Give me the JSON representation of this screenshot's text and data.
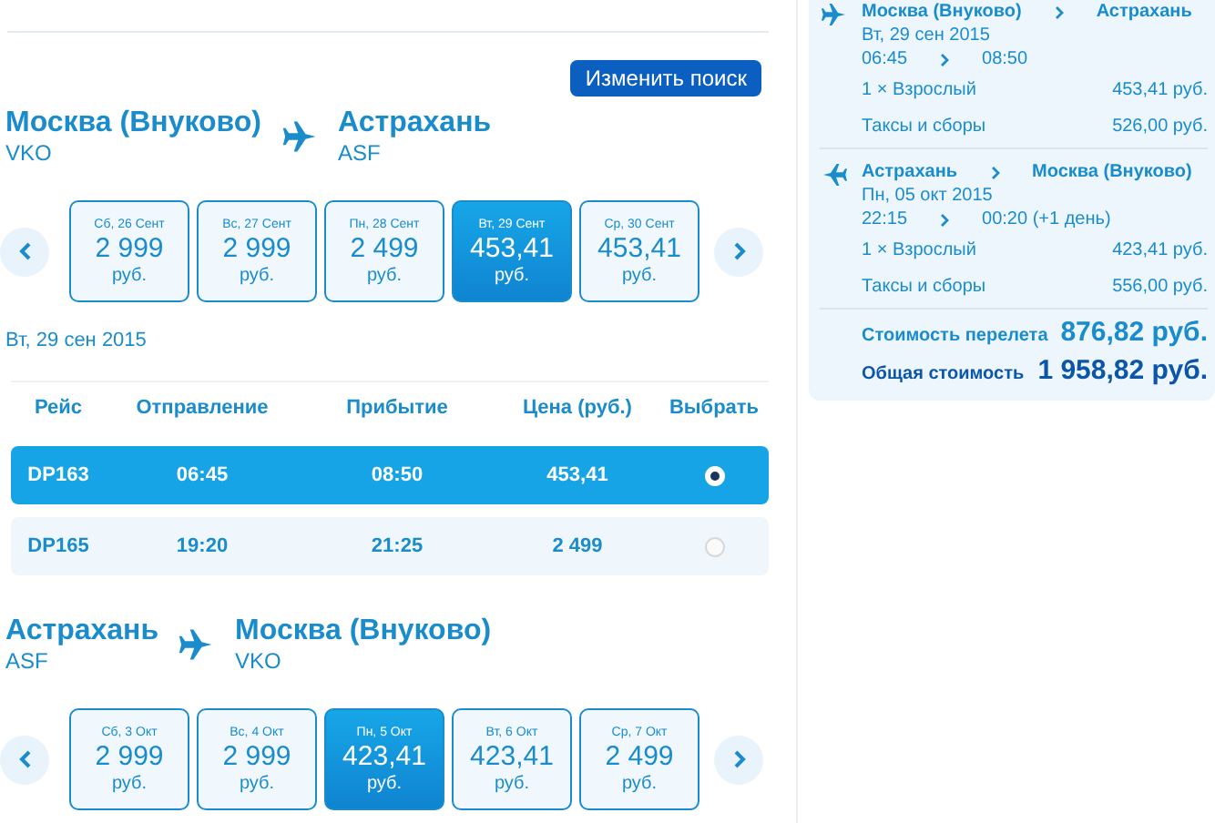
{
  "search_button": "Изменить поиск",
  "legs": [
    {
      "from": {
        "city": "Москва (Внуково)",
        "code": "VKO"
      },
      "to": {
        "city": "Астрахань",
        "code": "ASF"
      },
      "dates": [
        {
          "day": "Сб, 26 Сент",
          "price": "2 999",
          "currency": "руб.",
          "selected": false
        },
        {
          "day": "Вс, 27 Сент",
          "price": "2 999",
          "currency": "руб.",
          "selected": false
        },
        {
          "day": "Пн, 28 Сент",
          "price": "2 499",
          "currency": "руб.",
          "selected": false
        },
        {
          "day": "Вт, 29 Сент",
          "price": "453,41",
          "currency": "руб.",
          "selected": true
        },
        {
          "day": "Ср, 30 Сент",
          "price": "453,41",
          "currency": "руб.",
          "selected": false
        }
      ],
      "date_heading": "Вт, 29 сен 2015",
      "columns": [
        "Рейс",
        "Отправление",
        "Прибытие",
        "Цена (руб.)",
        "Выбрать"
      ],
      "flights": [
        {
          "flight": "DP163",
          "departure": "06:45",
          "arrival": "08:50",
          "price": "453,41",
          "selected": true
        },
        {
          "flight": "DP165",
          "departure": "19:20",
          "arrival": "21:25",
          "price": "2 499",
          "selected": false
        }
      ]
    },
    {
      "from": {
        "city": "Астрахань",
        "code": "ASF"
      },
      "to": {
        "city": "Москва (Внуково)",
        "code": "VKO"
      },
      "dates": [
        {
          "day": "Сб, 3 Окт",
          "price": "2 999",
          "currency": "руб.",
          "selected": false
        },
        {
          "day": "Вс, 4 Окт",
          "price": "2 999",
          "currency": "руб.",
          "selected": false
        },
        {
          "day": "Пн, 5 Окт",
          "price": "423,41",
          "currency": "руб.",
          "selected": true
        },
        {
          "day": "Вт, 6 Окт",
          "price": "423,41",
          "currency": "руб.",
          "selected": false
        },
        {
          "day": "Ср, 7 Окт",
          "price": "2 499",
          "currency": "руб.",
          "selected": false
        }
      ]
    }
  ],
  "summary": {
    "segments": [
      {
        "kind": "outbound",
        "from": "Москва (Внуково)",
        "to": "Астрахань",
        "date": "Вт, 29 сен 2015",
        "depart": "06:45",
        "arrive": "08:50",
        "lines": [
          {
            "label": "1 × Взрослый",
            "amount": "453,41 руб."
          },
          {
            "label": "Таксы и сборы",
            "amount": "526,00 руб."
          }
        ]
      },
      {
        "kind": "return",
        "from": "Астрахань",
        "to": "Москва (Внуково)",
        "date": "Пн, 05 окт 2015",
        "depart": "22:15",
        "arrive": "00:20 (+1 день)",
        "lines": [
          {
            "label": "1 × Взрослый",
            "amount": "423,41 руб."
          },
          {
            "label": "Таксы и сборы",
            "amount": "556,00 руб."
          }
        ]
      }
    ],
    "totals": [
      {
        "kind": "fare",
        "label": "Стоимость перелета",
        "amount": "876,82 руб."
      },
      {
        "kind": "total",
        "label": "Общая стоимость",
        "amount": "1 958,82 руб."
      }
    ]
  }
}
